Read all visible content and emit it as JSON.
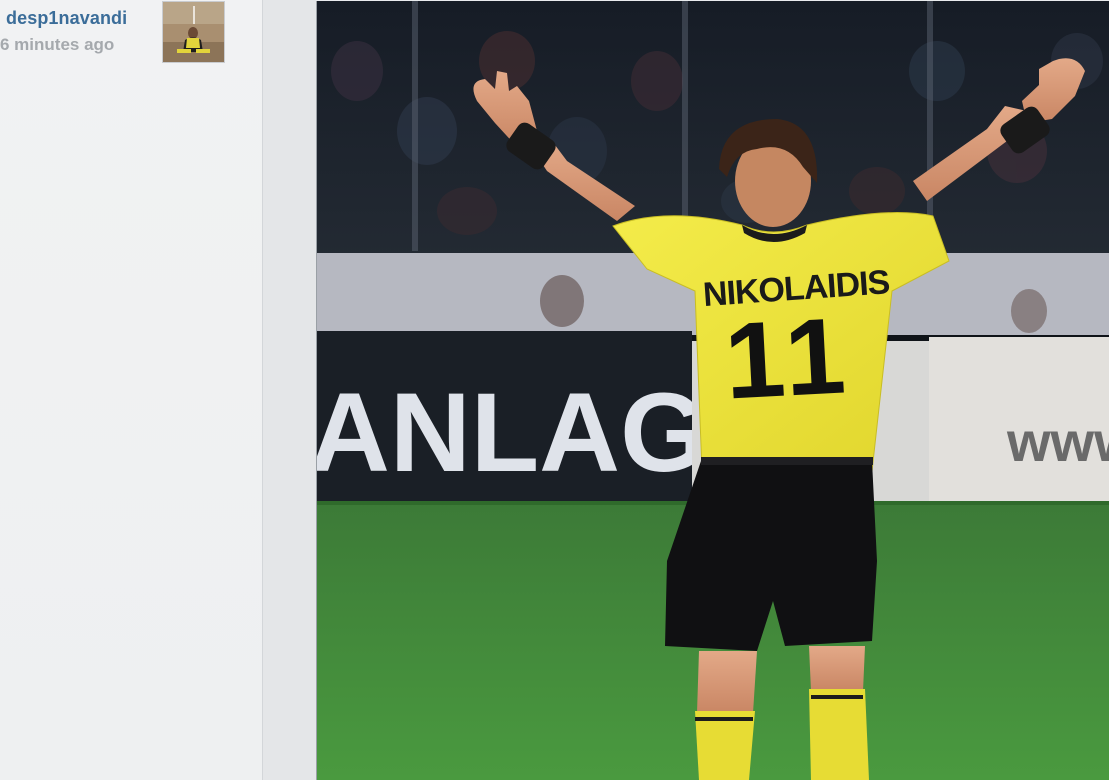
{
  "post": {
    "username": "desp1navandi",
    "timestamp": "6 minutes ago"
  },
  "photo": {
    "banner_text": "ANLAGE",
    "board_text": "www",
    "jersey_name": "NIKOLAIDIS",
    "jersey_number": "11"
  },
  "colors": {
    "username": "#3b6d99",
    "timestamp": "#a5a9ad",
    "jersey": "#f1e83a",
    "pitch": "#3f8a38"
  }
}
